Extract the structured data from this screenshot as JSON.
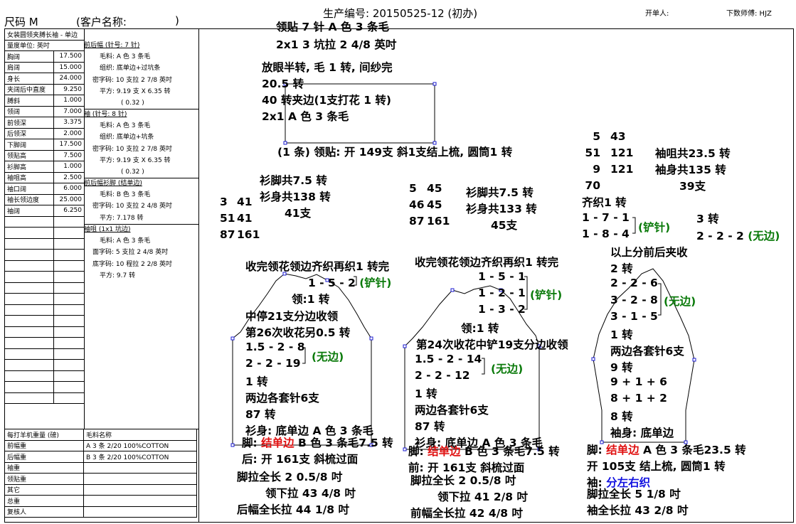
{
  "header": {
    "size_label": "尺码 M",
    "customer_label": "(客户名称:",
    "customer_close": ")",
    "production_no": "生产编号: 20150525-12 (初办)",
    "order_person": "开单人:",
    "master": "下数师傅: HJZ"
  },
  "spec_title": "女装圆领夹膊长袖 - 单边",
  "spec_unit": "量度单位: 英吋",
  "measurements": [
    {
      "label": "胸阔",
      "value": "17.500"
    },
    {
      "label": "肩阔",
      "value": "15.000"
    },
    {
      "label": "身长",
      "value": "24.000"
    },
    {
      "label": "夹阔后中直度",
      "value": "9.250"
    },
    {
      "label": "膊斜",
      "value": "1.000"
    },
    {
      "label": "领阔",
      "value": "7.000"
    },
    {
      "label": "前领深",
      "value": "3.375"
    },
    {
      "label": "后领深",
      "value": "2.000"
    },
    {
      "label": "下脚阔",
      "value": "17.500"
    },
    {
      "label": "领贴高",
      "value": "7.500"
    },
    {
      "label": "衫脚高",
      "value": "1.000"
    },
    {
      "label": "袖咀高",
      "value": "2.500"
    },
    {
      "label": "袖口阔",
      "value": "6.000"
    },
    {
      "label": "袖长领边度",
      "value": "25.000"
    },
    {
      "label": "袖阔",
      "value": "6.250"
    }
  ],
  "panels": {
    "front_back": [
      "前后幅 (针号: 7 针)",
      "毛料: A 色 3 条毛",
      "组织: 底单边+过坑条",
      "密字码: 10 支拉 2 7/8 英吋",
      "平方: 9.19 支 X 6.35 转",
      "( 0.32 )"
    ],
    "sleeve": [
      "袖 (针号: 8 针)",
      "毛料: A 色 3 条毛",
      "组织: 底单边+坑条",
      "密字码: 10 支拉 2 7/8 英吋",
      "平方: 9.19 支 X 6.35 转",
      "( 0.32 )"
    ],
    "hem": [
      "前后幅衫脚 (结单边)",
      "毛料: B 色 3 条毛",
      "密字码: 10 支拉 2 4/8 英吋",
      "平方: 7.178 转"
    ],
    "cuff": [
      "袖咀 (1x1 坑边)",
      "毛料: A 色 3 条毛",
      "面字码: 5 支拉 2 4/8 英吋",
      "底字码: 10 程拉 2 2/8 英吋",
      "平方: 9.7 转"
    ]
  },
  "yarn": {
    "header": "每打羊机重量 (磅)",
    "name_header": "毛料名称",
    "rows": [
      {
        "label": "前幅重",
        "name": "A 3 条 2/20 100%COTTON"
      },
      {
        "label": "后幅重",
        "name": "B 3 条 2/20 100%COTTON"
      },
      {
        "label": "袖重",
        "name": ""
      },
      {
        "label": "领贴重",
        "name": ""
      },
      {
        "label": "其它",
        "name": ""
      },
      {
        "label": "总重",
        "name": ""
      },
      {
        "label": "复核人",
        "name": ""
      }
    ]
  },
  "collar": {
    "l1": "领贴 7 针 A 色 3 条毛",
    "l2": "2x1   3 坑拉 2 4/8 英吋",
    "l3": "放眼半转, 毛 1 转, 间纱完",
    "l4": "20.5 转",
    "l5": "40 转夹边(1支打花 1 转)",
    "l6": "2x1   A 色 3 条毛",
    "l7": "(1 条) 领贴: 开 149支 斜1支结上梳, 圆筒1 转"
  },
  "back": {
    "col1": [
      "3",
      "51",
      "87"
    ],
    "col2": [
      "41",
      "41",
      "161"
    ],
    "h1": "衫脚共7.5 转",
    "h2": "衫身共138 转",
    "h3": "41支",
    "t1": "收完领花领边齐织再织1 转完",
    "t2": "1 - 5 - 2",
    "t2g": "(铲针)",
    "t3": "领:1 转",
    "t4": "中停21支分边收领",
    "t5": "第26次收花另0.5 转",
    "t6": "1.5 - 2 - 8",
    "t7": "2 - 2 - 19",
    "t7g": "(无边)",
    "t8": "1 转",
    "t9": "两边各套针6支",
    "t10": "87 转",
    "t11": "衫身: 底单边 A 色 3 条毛",
    "t12a": "脚: ",
    "t12r": "结单边",
    "t12b": "  B 色 3 条毛7.5 转",
    "t13": "后: 开 161支 斜梳过面",
    "t14": "脚拉全长 2  0.5/8 吋",
    "t15": "领下拉 43 4/8 吋",
    "t16": "后幅全长拉 44 1/8 吋"
  },
  "front": {
    "col1": [
      "5",
      "46",
      "87"
    ],
    "col2": [
      "45",
      "45",
      "161"
    ],
    "h1": "衫脚共7.5 转",
    "h2": "衫身共133 转",
    "h3": "45支",
    "t1": "收完领花领边齐织再织1 转完",
    "t2": "1 - 5 - 1",
    "t3": "1 - 2 - 1",
    "t4": "1 - 3 - 2",
    "t3g": "(铲针)",
    "t5": "领:1 转",
    "t6": "第24次收花中铲19支分边收领",
    "t7": "1.5 - 2 - 14",
    "t8": "2 - 2 - 12",
    "t8g": "(无边)",
    "t9": "1 转",
    "t10": "两边各套针6支",
    "t11": "87 转",
    "t12": "衫身: 底单边 A 色 3 条毛",
    "t13a": "脚: ",
    "t13r": "结单边",
    "t13b": "  B 色 3 条毛7.5 转",
    "t14": "前: 开 161支 斜梳过面",
    "t15": "脚拉全长 2  0.5/8 吋",
    "t16": "领下拉 41 2/8 吋",
    "t17": "前幅全长拉 42 4/8 吋"
  },
  "sleeve": {
    "col1": [
      "5",
      "51",
      "9",
      "70"
    ],
    "col2": [
      "",
      "43",
      "121",
      "121"
    ],
    "h1": "袖咀共23.5 转",
    "h2": "袖身共135 转",
    "h3": "39支",
    "t1": "齐织1 转",
    "t2": "1 - 7 - 1",
    "t3": "1 - 8 - 4",
    "t3g": "(铲针)",
    "t4": "3 转",
    "t5": "2 - 2 - 2",
    "t5g": "(无边)",
    "t6": "以上分前后夹收",
    "t7": "2 转",
    "t8": "2 - 2 - 6",
    "t9": "3 - 2 - 8",
    "t10": "3 - 1 - 5",
    "t9g": "(无边)",
    "t11": "1 转",
    "t12": "两边各套针6支",
    "t13": "9 转",
    "t14": "9 + 1 + 6",
    "t15": "8 + 1 + 2",
    "t16": "8 转",
    "t17": "袖身: 底单边",
    "t18a": "脚: ",
    "t18r": "结单边",
    "t18b": "  A 色 3 条毛23.5 转",
    "t19": "开 105支 结上梳, 圆筒1 转",
    "t20a": "袖: ",
    "t20c": "分左右织",
    "t21": "脚拉全长 5 1/8 吋",
    "t22": "袖全长拉 43 2/8 吋"
  }
}
